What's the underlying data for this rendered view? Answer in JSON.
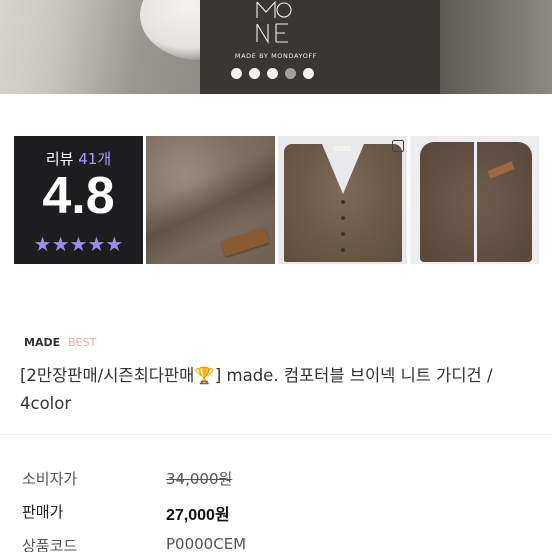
{
  "banner": {
    "logo_text": "MONDAYOFF",
    "caption": "MADE BY MONDAYOFF",
    "dots": [
      {
        "state": "active"
      },
      {
        "state": "active"
      },
      {
        "state": "active"
      },
      {
        "state": "dim"
      },
      {
        "state": "active"
      }
    ]
  },
  "review": {
    "label": "리뷰",
    "count": "41개",
    "score": "4.8",
    "stars": "★★★★★",
    "star_count": 5,
    "accent_color": "#9b8cf2"
  },
  "thumbnails": [
    {
      "name": "review-summary"
    },
    {
      "name": "knit-closeup-photo"
    },
    {
      "name": "cardigan-flatlay-photo"
    },
    {
      "name": "cardigan-folded-photo"
    }
  ],
  "product": {
    "badges": {
      "made": "MADE",
      "best": "BEST"
    },
    "title": "[2만장판매/시즌최다판매🏆] made. 컴포터블 브이넥 니트 가디건 / 4color",
    "rows": {
      "consumer_price": {
        "label": "소비자가",
        "value": "34,000원"
      },
      "sale_price": {
        "label": "판매가",
        "value": "27,000원"
      },
      "product_code": {
        "label": "상품코드",
        "value": "P0000CEM"
      }
    }
  },
  "colors": {
    "best_badge": "#f0a8a8",
    "review_bg": "#1d1d1f",
    "star": "#9b8cf2"
  }
}
